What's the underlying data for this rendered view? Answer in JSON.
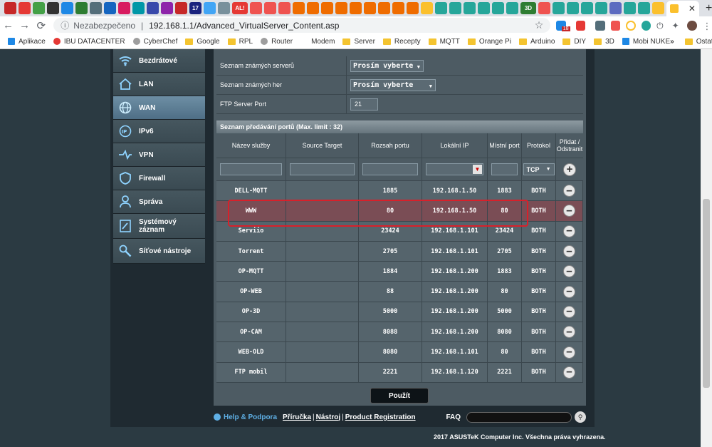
{
  "browser": {
    "active_tab_close": "✕",
    "new_tab": "+",
    "tab_badge_ali": "AL!",
    "tab_badge_3d": "3D",
    "tab_badge_17": "17",
    "security_label": "Nezabezpečeno",
    "url": "192.168.1.1/Advanced_VirtualServer_Content.asp",
    "ext_badge": "18",
    "bookmarks": [
      "Aplikace",
      "IBU DATACENTER",
      "CyberChef",
      "Google",
      "RPL",
      "Router",
      "Modem",
      "Server",
      "Recepty",
      "MQTT",
      "Orange Pi",
      "Arduino",
      "DIY",
      "3D",
      "Mobi NUKE"
    ],
    "bookmarks_more": "»",
    "bookmarks_other": "Ostatní záložky"
  },
  "sidebar": {
    "items": [
      {
        "label": "Bezdrátové",
        "icon": "wifi-icon",
        "active": false
      },
      {
        "label": "LAN",
        "icon": "home-icon",
        "active": false
      },
      {
        "label": "WAN",
        "icon": "globe-icon",
        "active": true
      },
      {
        "label": "IPv6",
        "icon": "ipv6-icon",
        "active": false
      },
      {
        "label": "VPN",
        "icon": "vpn-icon",
        "active": false
      },
      {
        "label": "Firewall",
        "icon": "shield-icon",
        "active": false
      },
      {
        "label": "Správa",
        "icon": "person-icon",
        "active": false
      },
      {
        "label": "Systémový záznam",
        "icon": "log-icon",
        "active": false
      },
      {
        "label": "Síťové nástroje",
        "icon": "tools-icon",
        "active": false
      }
    ]
  },
  "form": {
    "known_servers_label": "Seznam známých serverů",
    "known_servers_value": "Prosím vyberte",
    "known_games_label": "Seznam známých her",
    "known_games_value": "Prosím vyberte",
    "ftp_port_label": "FTP Server Port",
    "ftp_port_value": "21"
  },
  "port_forward": {
    "header": "Seznam předávání portů (Max. limit : 32)",
    "columns": [
      "Název služby",
      "Source Target",
      "Rozsah portu",
      "Lokální IP",
      "Místní port",
      "Protokol",
      "Přidat / Odstranit"
    ],
    "protocol_default": "TCP",
    "add_symbol": "+",
    "remove_symbol": "−",
    "rows": [
      {
        "name": "DELL-MQTT",
        "source": "",
        "range": "1885",
        "ip": "192.168.1.50",
        "port": "1883",
        "proto": "BOTH",
        "highlight": false
      },
      {
        "name": "WWW",
        "source": "",
        "range": "80",
        "ip": "192.168.1.50",
        "port": "80",
        "proto": "BOTH",
        "highlight": true
      },
      {
        "name": "Serviio",
        "source": "",
        "range": "23424",
        "ip": "192.168.1.101",
        "port": "23424",
        "proto": "BOTH",
        "highlight": false
      },
      {
        "name": "Torrent",
        "source": "",
        "range": "2705",
        "ip": "192.168.1.101",
        "port": "2705",
        "proto": "BOTH",
        "highlight": false
      },
      {
        "name": "OP-MQTT",
        "source": "",
        "range": "1884",
        "ip": "192.168.1.200",
        "port": "1883",
        "proto": "BOTH",
        "highlight": false
      },
      {
        "name": "OP-WEB",
        "source": "",
        "range": "88",
        "ip": "192.168.1.200",
        "port": "80",
        "proto": "BOTH",
        "highlight": false
      },
      {
        "name": "OP-3D",
        "source": "",
        "range": "5000",
        "ip": "192.168.1.200",
        "port": "5000",
        "proto": "BOTH",
        "highlight": false
      },
      {
        "name": "OP-CAM",
        "source": "",
        "range": "8088",
        "ip": "192.168.1.200",
        "port": "8080",
        "proto": "BOTH",
        "highlight": false
      },
      {
        "name": "WEB-OLD",
        "source": "",
        "range": "8080",
        "ip": "192.168.1.101",
        "port": "80",
        "proto": "BOTH",
        "highlight": false
      },
      {
        "name": "FTP mobil",
        "source": "",
        "range": "2221",
        "ip": "192.168.1.120",
        "port": "2221",
        "proto": "BOTH",
        "highlight": false
      }
    ]
  },
  "apply_label": "Použít",
  "footer": {
    "help": "Help & Podpora",
    "manual": "Příručka",
    "tool": "Nástroj",
    "registration": "Product Registration",
    "faq": "FAQ",
    "copyright": "2017 ASUSTeK Computer Inc. Všechna práva vyhrazena."
  },
  "colors": {
    "accent": "#5fb0e6",
    "highlight": "#d8202a",
    "panel": "#4d5b63"
  }
}
